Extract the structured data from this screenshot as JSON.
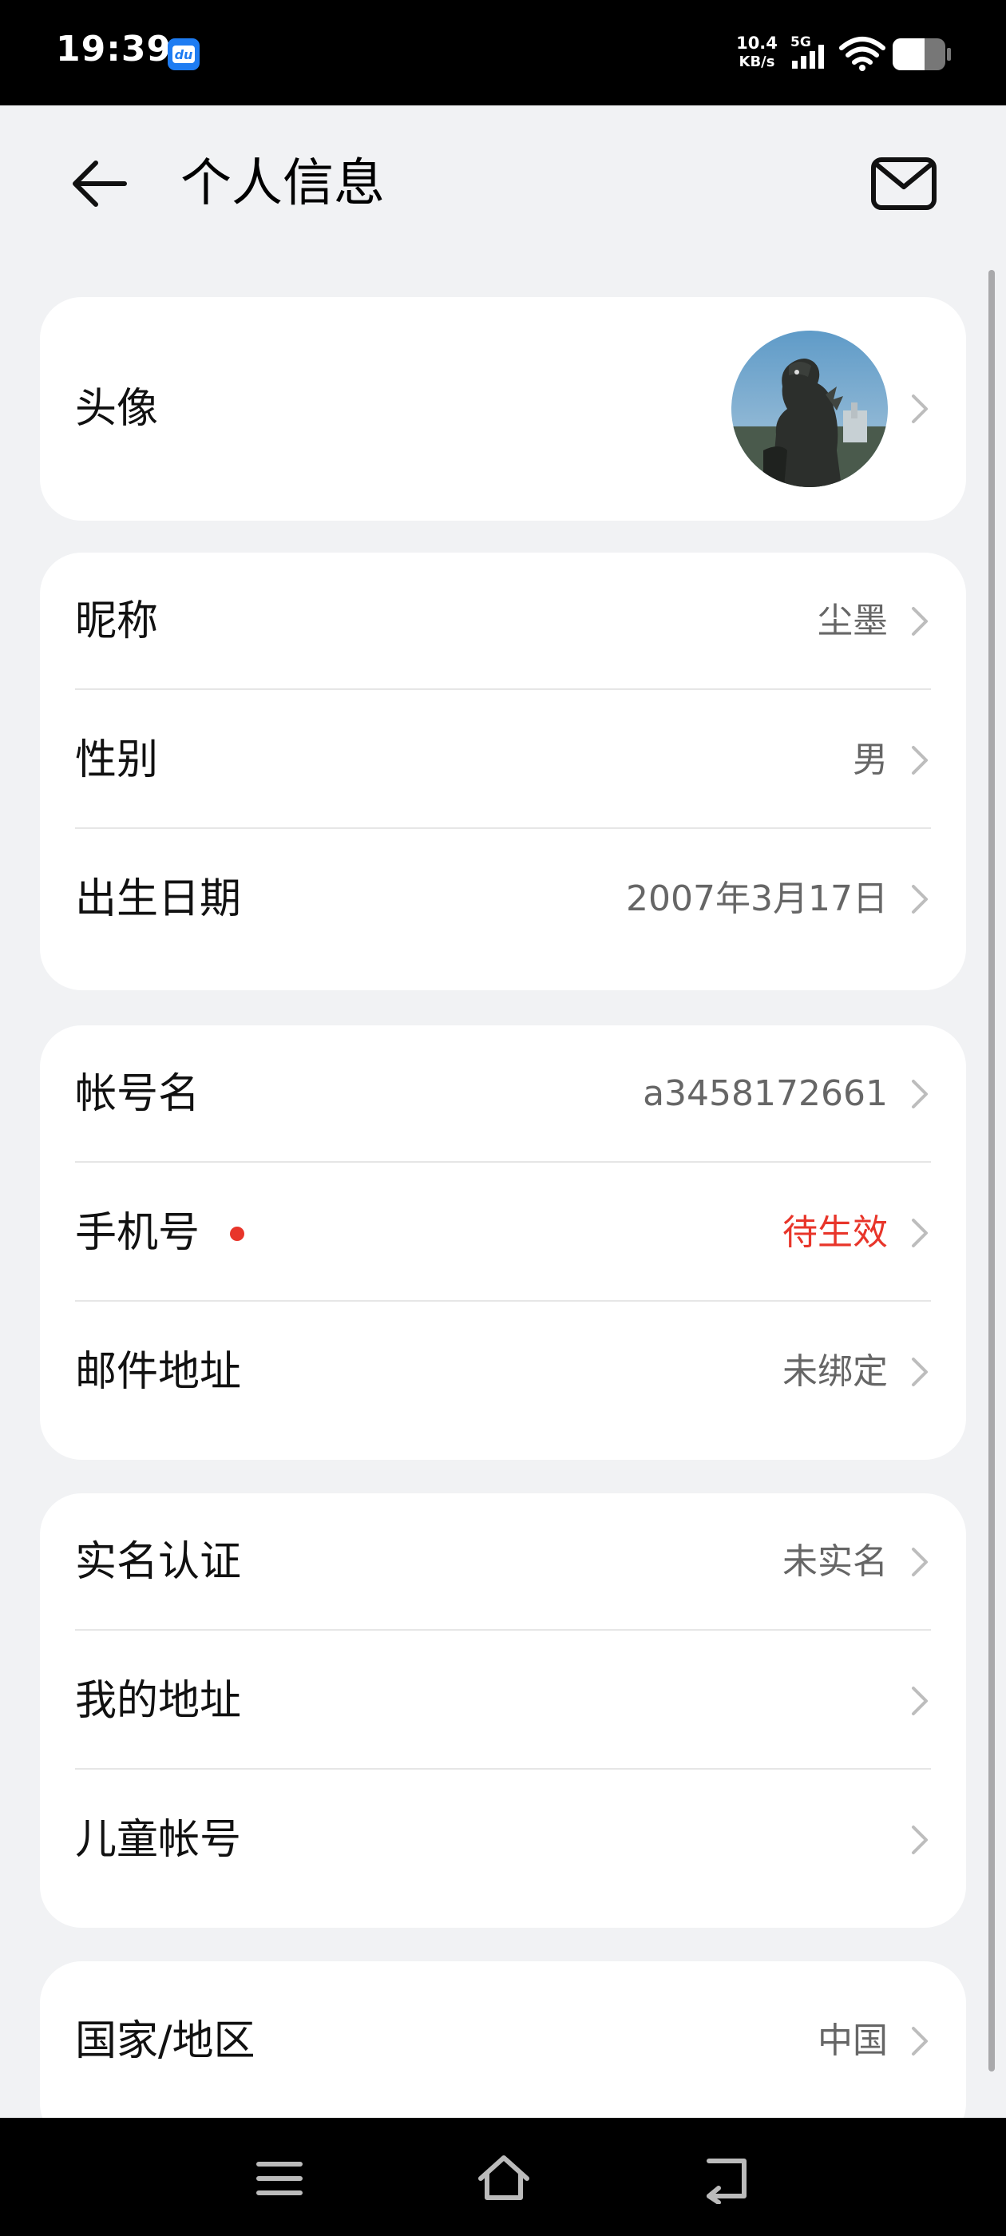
{
  "status_bar": {
    "time": "19:39",
    "app_badge": "du",
    "net_speed_value": "10.4",
    "net_speed_unit": "KB/s",
    "network": "5G",
    "icons": [
      "signal-icon",
      "wifi-icon",
      "battery-icon"
    ]
  },
  "header": {
    "title": "个人信息",
    "back_icon": "arrow-left-icon",
    "mail_icon": "mail-icon"
  },
  "sections": [
    {
      "rows": [
        {
          "label": "头像",
          "avatar": "godzilla avatar photo"
        }
      ]
    },
    {
      "rows": [
        {
          "label": "昵称",
          "value": "尘墨"
        },
        {
          "label": "性别",
          "value": "男"
        },
        {
          "label": "出生日期",
          "value": "2007年3月17日"
        }
      ]
    },
    {
      "rows": [
        {
          "label": "帐号名",
          "value": "a3458172661"
        },
        {
          "label": "手机号",
          "value": "待生效",
          "alert": true,
          "value_color": "#e8352a"
        },
        {
          "label": "邮件地址",
          "value": "未绑定"
        }
      ]
    },
    {
      "rows": [
        {
          "label": "实名认证",
          "value": "未实名"
        },
        {
          "label": "我的地址",
          "value": ""
        },
        {
          "label": "儿童帐号",
          "value": ""
        }
      ]
    },
    {
      "rows": [
        {
          "label": "国家/地区",
          "value": "中国"
        }
      ]
    }
  ],
  "colors": {
    "background": "#f1f2f4",
    "card": "#ffffff",
    "alert": "#e8352a",
    "secondary_text": "#666666"
  },
  "nav_bar": {
    "icons": [
      "menu-icon",
      "home-icon",
      "back-icon"
    ]
  }
}
